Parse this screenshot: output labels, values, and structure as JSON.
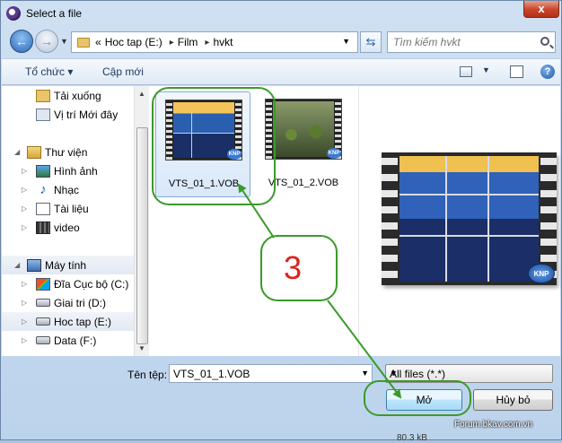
{
  "window": {
    "title": "Select a file",
    "close_glyph": "x"
  },
  "nav": {
    "back_glyph": "←",
    "forward_glyph": "→",
    "breadcrumb": [
      "Hoc tap (E:)",
      "Film",
      "hvkt"
    ],
    "breadcrumb_lead": "«",
    "search_placeholder": "Tìm kiếm hvkt"
  },
  "toolbar": {
    "organize": "Tổ chức ▾",
    "new_folder": "Cập mới",
    "help": "?"
  },
  "sidebar": {
    "items": [
      {
        "label": "Tải xuống",
        "icon": "download-folder-icon"
      },
      {
        "label": "Vị trí Mới đây",
        "icon": "recent-places-icon"
      },
      {
        "label": "Thư viện",
        "icon": "library-icon"
      },
      {
        "label": "Hình ảnh",
        "icon": "pictures-icon"
      },
      {
        "label": "Nhạc",
        "icon": "music-icon"
      },
      {
        "label": "Tài liệu",
        "icon": "documents-icon"
      },
      {
        "label": "video",
        "icon": "video-icon"
      },
      {
        "label": "Máy tính",
        "icon": "computer-icon"
      },
      {
        "label": "Đĩa Cục bộ (C:)",
        "icon": "system-drive-icon"
      },
      {
        "label": "Giai tri (D:)",
        "icon": "drive-icon"
      },
      {
        "label": "Hoc tap (E:)",
        "icon": "drive-icon"
      },
      {
        "label": "Data (F:)",
        "icon": "drive-icon"
      }
    ]
  },
  "files": [
    {
      "name": "VTS_01_1.VOB",
      "selected": true,
      "badge": "KNP"
    },
    {
      "name": "VTS_01_2.VOB",
      "selected": false,
      "badge": "KNP"
    }
  ],
  "preview": {
    "badge": "KNP"
  },
  "footer": {
    "filename_label": "Tên tệp:",
    "filename_value": "VTS_01_1.VOB",
    "filetype_value": "All files (*.*)",
    "open_button": "Mở",
    "cancel_button": "Hủy bỏ",
    "watermark": "Forum.bkav.com.vn",
    "background_text": "80.3 kB"
  },
  "annotation": {
    "step": "3",
    "color": "#3a9a2a",
    "text_color": "#e0201b"
  }
}
